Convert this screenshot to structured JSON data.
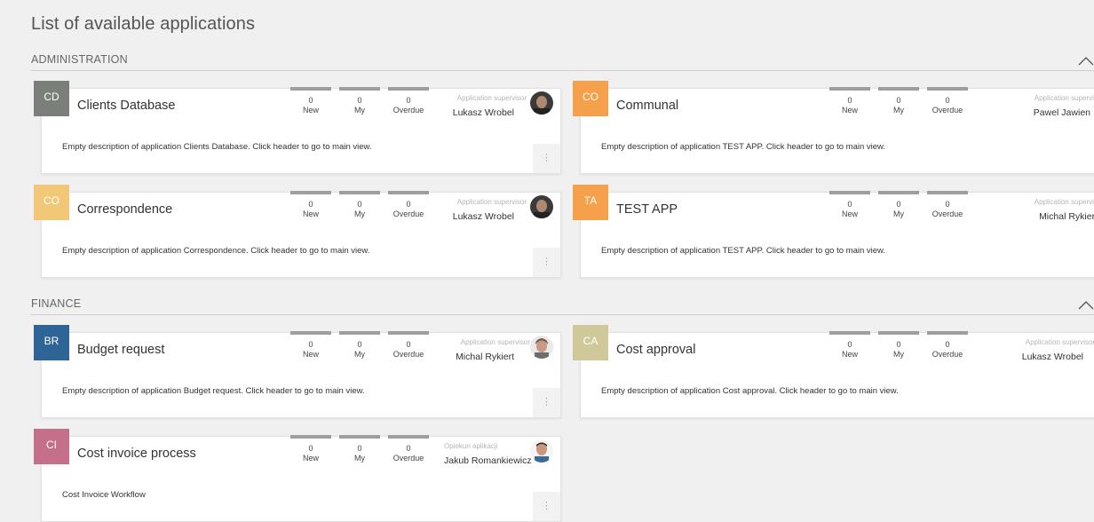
{
  "page": {
    "title": "List of available applications"
  },
  "sections": [
    {
      "title": "ADMINISTRATION",
      "cards": [
        {
          "code": "CD",
          "color": "#7b7f7a",
          "name": "Clients Database",
          "stats": [
            {
              "value": "0",
              "label": "New"
            },
            {
              "value": "0",
              "label": "My"
            },
            {
              "value": "0",
              "label": "Overdue"
            }
          ],
          "supervisor_label": "Application supervisor",
          "supervisor_name": "Lukasz Wrobel",
          "description": "Empty description of application Clients Database. Click header to go to main view.",
          "more": "⋮"
        },
        {
          "code": "CO",
          "color": "#f7a04c",
          "name": "Communal",
          "stats": [
            {
              "value": "0",
              "label": "New"
            },
            {
              "value": "0",
              "label": "My"
            },
            {
              "value": "0",
              "label": "Overdue"
            }
          ],
          "supervisor_label": "Application supervisor",
          "supervisor_name": "Pawel Jawien",
          "description": "Empty description of application TEST APP. Click header to go to main view.",
          "more": "⋮"
        },
        {
          "code": "CO",
          "color": "#f2c878",
          "name": "Correspondence",
          "stats": [
            {
              "value": "0",
              "label": "New"
            },
            {
              "value": "0",
              "label": "My"
            },
            {
              "value": "0",
              "label": "Overdue"
            }
          ],
          "supervisor_label": "Application supervisor",
          "supervisor_name": "Lukasz Wrobel",
          "description": "Empty description of application Correspondence. Click header to go to main view.",
          "more": "⋮"
        },
        {
          "code": "TA",
          "color": "#f7a04c",
          "name": "TEST APP",
          "stats": [
            {
              "value": "0",
              "label": "New"
            },
            {
              "value": "0",
              "label": "My"
            },
            {
              "value": "0",
              "label": "Overdue"
            }
          ],
          "supervisor_label": "Application supervisor",
          "supervisor_name": "Michal Rykiert",
          "description": "Empty description of application TEST APP. Click header to go to main view.",
          "more": "⋮"
        }
      ]
    },
    {
      "title": "FINANCE",
      "cards": [
        {
          "code": "BR",
          "color": "#2f6496",
          "name": "Budget request",
          "stats": [
            {
              "value": "0",
              "label": "New"
            },
            {
              "value": "0",
              "label": "My"
            },
            {
              "value": "0",
              "label": "Overdue"
            }
          ],
          "supervisor_label": "Application supervisor",
          "supervisor_name": "Michal Rykiert",
          "description": "Empty description of application Budget request. Click header to go to main view.",
          "more": "⋮"
        },
        {
          "code": "CA",
          "color": "#cfc99a",
          "name": "Cost approval",
          "stats": [
            {
              "value": "0",
              "label": "New"
            },
            {
              "value": "0",
              "label": "My"
            },
            {
              "value": "0",
              "label": "Overdue"
            }
          ],
          "supervisor_label": "Application supervisor",
          "supervisor_name": "Lukasz Wrobel",
          "description": "Empty description of application Cost approval. Click header to go to main view.",
          "more": "⋮"
        },
        {
          "code": "CI",
          "color": "#c5708a",
          "name": "Cost invoice process",
          "stats": [
            {
              "value": "0",
              "label": "New"
            },
            {
              "value": "0",
              "label": "My"
            },
            {
              "value": "0",
              "label": "Overdue"
            }
          ],
          "supervisor_label": "Opiekun aplikacji",
          "supervisor_name": "Jakub Romankiewicz",
          "description": "Cost Invoice Workflow",
          "more": "⋮"
        }
      ]
    }
  ]
}
